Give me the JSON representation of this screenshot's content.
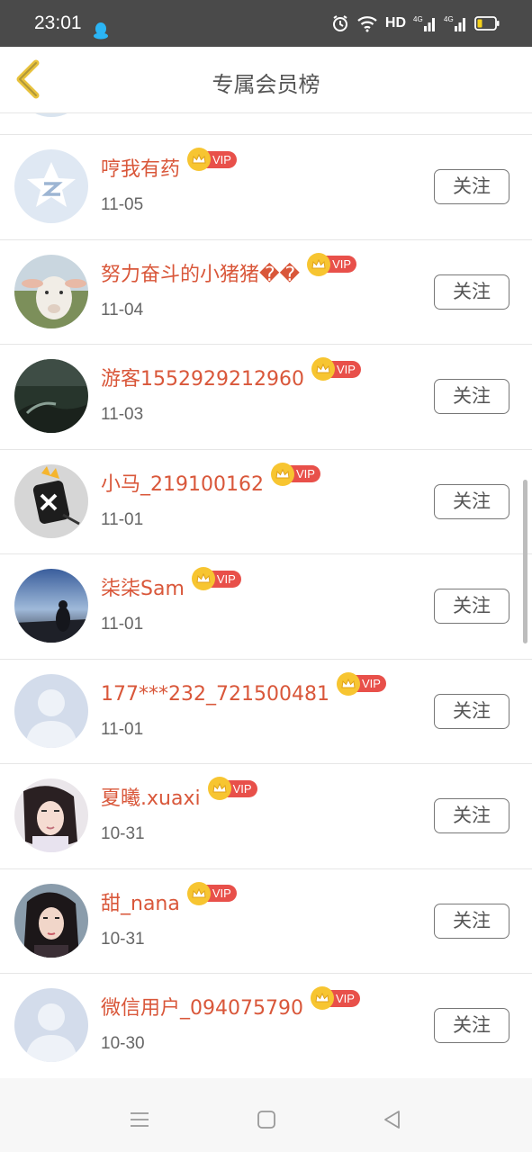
{
  "status_bar": {
    "time": "23:01",
    "icons": [
      "qq-icon",
      "alarm-icon",
      "wifi-icon",
      "signal-4g-icon",
      "signal-4g-icon",
      "battery-icon"
    ],
    "hd_label": "HD"
  },
  "header": {
    "title": "专属会员榜",
    "back_icon": "chevron-left-icon"
  },
  "colors": {
    "accent_name": "#d9573a",
    "vip_badge": "#e8504a",
    "crown": "#f7c531",
    "back_chevron": "#e8c23c"
  },
  "members": [
    {
      "name": "哼我有药",
      "badge": "VIP",
      "date": "11-05",
      "follow": "关注",
      "avatar": "qq-default-avatar"
    },
    {
      "name": "努力奋斗的小猪猪��",
      "badge": "VIP",
      "date": "11-04",
      "follow": "关注",
      "avatar": "sheep-photo-avatar"
    },
    {
      "name": "游客1552929212960",
      "badge": "VIP",
      "date": "11-03",
      "follow": "关注",
      "avatar": "dark-landscape-avatar"
    },
    {
      "name": "小马_219100162",
      "badge": "VIP",
      "date": "11-01",
      "follow": "关注",
      "avatar": "cartoon-avatar"
    },
    {
      "name": "柒柒Sam",
      "badge": "VIP",
      "date": "11-01",
      "follow": "关注",
      "avatar": "sunset-photo-avatar"
    },
    {
      "name": "177***232_721500481",
      "badge": "VIP",
      "date": "11-01",
      "follow": "关注",
      "avatar": "default-person-avatar"
    },
    {
      "name": "夏曦.xuaxi",
      "badge": "VIP",
      "date": "10-31",
      "follow": "关注",
      "avatar": "girl-photo-avatar"
    },
    {
      "name": "甜_nana",
      "badge": "VIP",
      "date": "10-31",
      "follow": "关注",
      "avatar": "girl-portrait-avatar"
    },
    {
      "name": "微信用户_094075790",
      "badge": "VIP",
      "date": "10-30",
      "follow": "关注",
      "avatar": "default-person-avatar"
    }
  ],
  "nav_bar": {
    "icons": [
      "menu-icon",
      "home-square-icon",
      "back-triangle-icon"
    ]
  }
}
